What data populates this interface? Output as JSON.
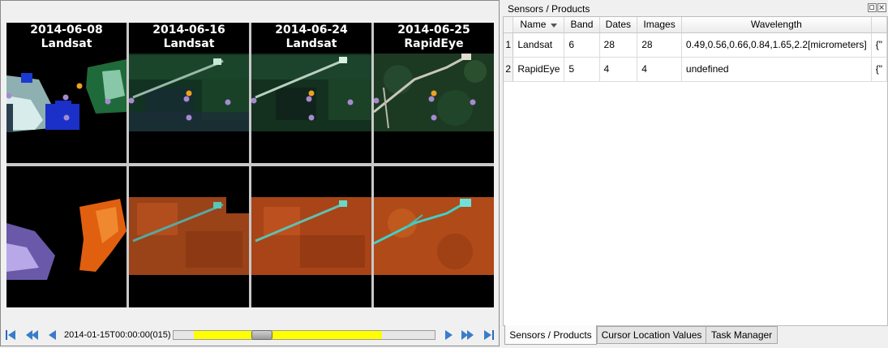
{
  "viewer": {
    "panels": [
      {
        "date": "2014-06-08",
        "sensor": "Landsat"
      },
      {
        "date": "2014-06-16",
        "sensor": "Landsat"
      },
      {
        "date": "2014-06-24",
        "sensor": "Landsat"
      },
      {
        "date": "2014-06-25",
        "sensor": "RapidEye"
      }
    ],
    "timebar": {
      "current_time": "2014-01-15T00:00:00(015)",
      "buttons": [
        "skip-first-icon",
        "step-back-icon",
        "play-back-icon",
        "play-forward-icon",
        "step-forward-icon",
        "skip-last-icon"
      ]
    }
  },
  "dock": {
    "title": "Sensors / Products",
    "columns": [
      "Name",
      "Band",
      "Dates",
      "Images",
      "Wavelength"
    ],
    "rows": [
      {
        "num": "1",
        "name": "Landsat",
        "band": "6",
        "dates": "28",
        "images": "28",
        "wavelength": "0.49,0.56,0.66,0.84,1.65,2.2[micrometers]",
        "extra": "{\""
      },
      {
        "num": "2",
        "name": "RapidEye",
        "band": "5",
        "dates": "4",
        "images": "4",
        "wavelength": "undefined",
        "extra": "{\""
      }
    ],
    "tabs": [
      "Sensors / Products",
      "Cursor Location Values",
      "Task Manager"
    ],
    "active_tab": "Sensors / Products"
  },
  "colors": {
    "slider_fill": "#ffff00",
    "point_orange": "#f0a020",
    "point_violet": "#a68ad0"
  }
}
